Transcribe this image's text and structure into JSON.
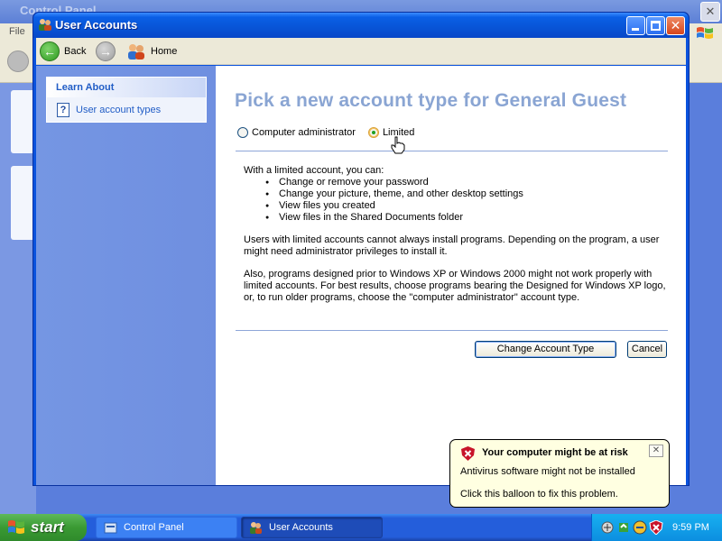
{
  "background_window": {
    "title": "Control Panel",
    "menu_first": "File"
  },
  "window": {
    "title": "User Accounts"
  },
  "toolbar": {
    "back_label": "Back",
    "home_label": "Home"
  },
  "sidebar": {
    "section_title": "Learn About",
    "items": [
      {
        "label": "User account types"
      }
    ]
  },
  "main": {
    "heading": "Pick a new account type for General Guest",
    "options": [
      {
        "label": "Computer administrator",
        "selected": false
      },
      {
        "label": "Limited",
        "selected": true
      }
    ],
    "intro": "With a limited account, you can:",
    "bullets": [
      "Change or remove your password",
      "Change your picture, theme, and other desktop settings",
      "View files you created",
      "View files in the Shared Documents folder"
    ],
    "para1": "Users with limited accounts cannot always install programs. Depending on the program, a user might need administrator privileges to install it.",
    "para2": "Also, programs designed prior to Windows XP or Windows 2000 might not work properly with limited accounts. For best results, choose programs bearing the Designed for Windows XP logo, or, to run older programs, choose the \"computer administrator\" account type.",
    "change_button": "Change Account Type",
    "cancel_button": "Cancel"
  },
  "balloon": {
    "title": "Your computer might be at risk",
    "line1": "Antivirus software might not be installed",
    "line2": "Click this balloon to fix this problem."
  },
  "taskbar": {
    "start_label": "start",
    "tasks": [
      {
        "label": "Control Panel"
      },
      {
        "label": "User Accounts"
      }
    ],
    "clock": "9:59 PM"
  },
  "colors": {
    "title_blue": "#0a5fe6",
    "heading_blue": "#8aa5d3",
    "sidebar_blue": "#7596e3",
    "link_blue": "#215dc6",
    "balloon_yellow": "#ffffe1",
    "start_green": "#3a9a33"
  }
}
